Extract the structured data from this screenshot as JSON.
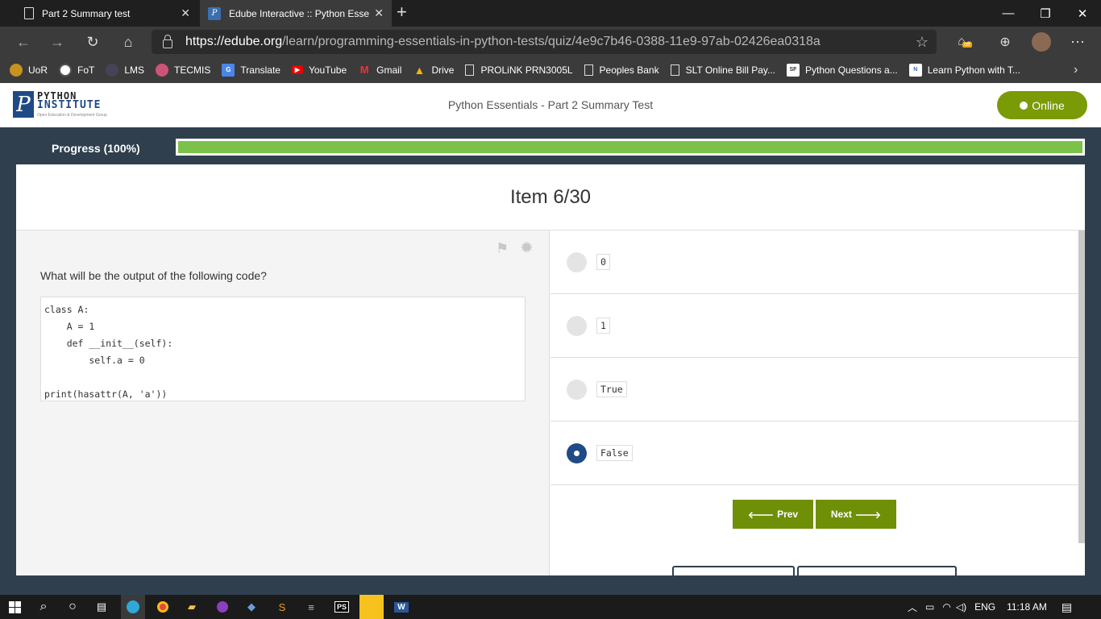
{
  "browser": {
    "tabs": [
      {
        "title": "Part 2 Summary test",
        "active": false
      },
      {
        "title": "Edube Interactive :: Python Essen",
        "active": true
      }
    ],
    "url_host": "https://edube.org",
    "url_path": "/learn/programming-essentials-in-python-tests/quiz/4e9c7b46-0388-11e9-97ab-02426ea0318a",
    "bookmarks": [
      "UoR",
      "FoT",
      "LMS",
      "TECMIS",
      "Translate",
      "YouTube",
      "Gmail",
      "Drive",
      "PROLiNK PRN3005L",
      "Peoples Bank",
      "SLT Online Bill Pay...",
      "Python Questions a...",
      "Learn Python with T..."
    ],
    "extension_badge": "off"
  },
  "header": {
    "logo_line1": "PYTHON",
    "logo_line2": "INSTITUTE",
    "logo_tagline": "Open Education & Development Group",
    "title": "Python Essentials - Part 2 Summary Test",
    "status": "Online"
  },
  "progress": {
    "label": "Progress (100%)",
    "fraction": 1.0
  },
  "quiz": {
    "item_label": "Item 6/30",
    "question": "What will be the output of the following code?",
    "code": "class A:\n    A = 1\n    def __init__(self):\n        self.a = 0\n\nprint(hasattr(A, 'a'))",
    "options": [
      {
        "value": "0",
        "selected": false
      },
      {
        "value": "1",
        "selected": false
      },
      {
        "value": "True",
        "selected": false
      },
      {
        "value": "False",
        "selected": true
      }
    ],
    "prev_label": "Prev",
    "next_label": "Next"
  },
  "taskbar": {
    "language": "ENG",
    "time": "11:18 AM"
  },
  "colors": {
    "accent_green": "#7a9a06",
    "progress_green": "#7cc24a",
    "brand_blue": "#1f4a86",
    "band": "#2f3f4e"
  }
}
